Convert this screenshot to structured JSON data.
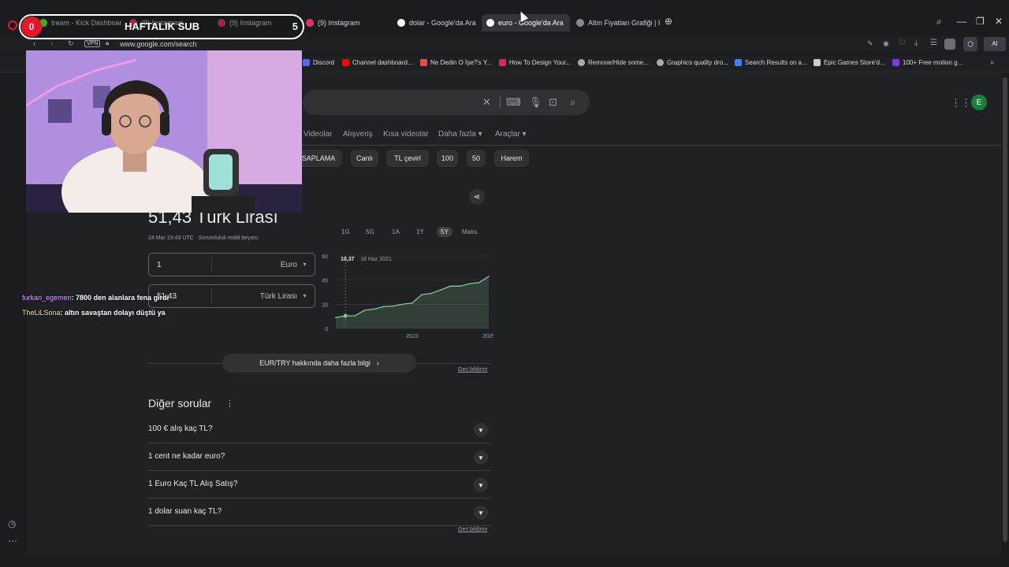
{
  "tabs": [
    {
      "label": "tream - Kick Dashboard",
      "fav": "#53fc18"
    },
    {
      "label": "(9) Instagram",
      "fav": "#e1306c"
    },
    {
      "label": "(9) Instagram",
      "fav": "#e1306c"
    },
    {
      "label": "(9) Instagram",
      "fav": "#e1306c"
    },
    {
      "label": "dolar - Google'da Ara",
      "fav": "#ffffff"
    },
    {
      "label": "euro - Google'da Ara",
      "fav": "#ffffff"
    },
    {
      "label": "Altın Fiyatları Grafiği | Han",
      "fav": "#888888"
    }
  ],
  "address": {
    "vpn": "VPN",
    "url": "www.google.com/search"
  },
  "bookmarks": [
    {
      "label": "Discord",
      "color": "#5865f2"
    },
    {
      "label": "Channel dashboard...",
      "color": "#ff0000"
    },
    {
      "label": "Ne Dedin O İşe?'s Y...",
      "color": "#ff4444"
    },
    {
      "label": "How To Design Your...",
      "color": "#e91e63"
    },
    {
      "label": "Remove/Hide some...",
      "color": "#aaaaaa"
    },
    {
      "label": "Graphics quality dro...",
      "color": "#aaaaaa"
    },
    {
      "label": "Search Results on a...",
      "color": "#3b82f6"
    },
    {
      "label": "Epic Games Store'd...",
      "color": "#cccccc"
    },
    {
      "label": "100+ Free motion g...",
      "color": "#7c3aed"
    }
  ],
  "extensions": {
    "ai": "AI"
  },
  "search": {
    "clear_icon": "✕",
    "nav": [
      "Videolar",
      "Alışveriş",
      "Kısa videolar",
      "Daha fazla ▾",
      "Araçlar ▾"
    ],
    "chips": [
      "SAPLAMA",
      "Canlı",
      "TL çevirl",
      "100",
      "50",
      "Harem"
    ],
    "avatar": "E"
  },
  "converter": {
    "value": "51,43 Türk Lirası",
    "meta": "24 Mar 15:43 UTC · Sorumluluk reddi beyanı",
    "amount": "1",
    "from": "Euro",
    "to_value": "51,43",
    "to": "Türk Lirası",
    "ranges": [
      "1G",
      "5G",
      "1A",
      "1Y",
      "5Y",
      "Maks."
    ],
    "selected_range": "5Y",
    "more_info": "EUR/TRY hakkında daha fazla bilgi",
    "feedback": "Geri bildirim"
  },
  "chart_data": {
    "type": "area",
    "x": [
      "2021-03",
      "2021-06",
      "2021-09",
      "2021-12",
      "2022-03",
      "2022-06",
      "2022-09",
      "2022-12",
      "2023-03",
      "2023-06",
      "2023-09",
      "2023-12",
      "2024-03",
      "2024-06",
      "2024-09",
      "2024-12",
      "2025-03"
    ],
    "series": [
      {
        "values": [
          9,
          10.37,
          10.5,
          15,
          16,
          18,
          18.5,
          20,
          21,
          28,
          29,
          32,
          35,
          35,
          37,
          38,
          43
        ]
      }
    ],
    "x_ticks": [
      "2023",
      "2025"
    ],
    "y_ticks": [
      0,
      20,
      40,
      60
    ],
    "ylim": [
      0,
      60
    ],
    "tooltip": {
      "value": "10,37",
      "date": "18 Haz 2021"
    },
    "color": "#81c995"
  },
  "paa": {
    "title": "Diğer sorular",
    "questions": [
      "100 € alış kaç TL?",
      "1 cent ne kadar euro?",
      "1 Euro Kaç TL Alış Satış?",
      "1 dolar suan kaç TL?"
    ],
    "feedback": "Geri bildirim"
  },
  "overlay": {
    "sub_left": "0",
    "sub_label": "HAFTALIK SUB",
    "sub_right": "5",
    "chat": [
      {
        "user": "furkan_egemen",
        "text": ": 7800 den alanlara fena girdi"
      },
      {
        "user": "TheLiLSona",
        "text": ": altın savaştan dolayı düştü ya"
      }
    ]
  }
}
